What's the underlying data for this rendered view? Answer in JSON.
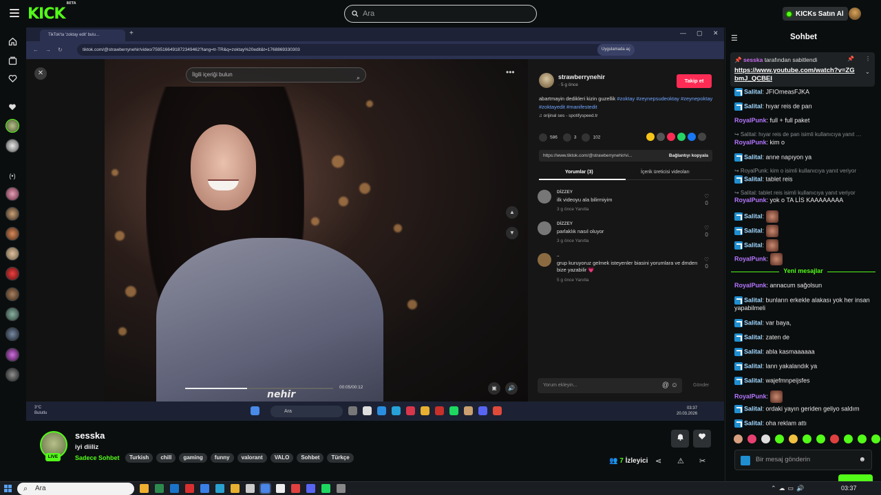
{
  "topbar": {
    "logo": "KICK",
    "logo_beta": "BETA",
    "search_placeholder": "Ara",
    "buy_kicks": "KICKs Satın Al"
  },
  "leftnav": {
    "icons": [
      "home-icon",
      "browse-icon",
      "following-icon",
      "followed-channels-icon",
      "recommended-icon"
    ]
  },
  "stream": {
    "browser": {
      "tab_title": "TikTok'ta 'zoktay edit' bulu…",
      "url": "tiktok.com/@strawberrynehir/video/7595166491872349462?lang=tr-TR&q=zoktay%20edit&t=1768869330303",
      "open_in_app": "Uygulamada aç"
    },
    "tiktok": {
      "search_placeholder": "İlgili içeriği bulun",
      "watermark": "nehir",
      "time": "00:05/00:12",
      "progress": 0.42,
      "username": "strawberrynehir",
      "date": "· 5 g önce",
      "follow": "Takip et",
      "description": "abartmayin dedikleri kizin guzellik",
      "hashtags": "#zoktay #zeynepsudeoktay #zeynepoktay #zoktayedit #manifestedit",
      "music": "♫ orijinal ses - spotifyspeed.tr",
      "likes": "586",
      "comments_count": "3",
      "saves": "102",
      "link": "https://www.tiktok.com/@strawberrynehir/vi...",
      "copy_link": "Bağlantıyı kopyala",
      "tab_comments": "Yorumlar (3)",
      "tab_creator": "İçerik üreticisi videoları",
      "comments": [
        {
          "name": "DİZZEY",
          "text": "ilk videoyu ala bilirmiyim",
          "meta": "3 g önce     Yanıtla",
          "likes": "0"
        },
        {
          "name": "DİZZEY",
          "text": "parlaklık nasıl oluyor",
          "meta": "3 g önce     Yanıtla",
          "likes": "0"
        },
        {
          "name": "..",
          "text": "grup kuruyoruz gelmek isteyenler biasini yorumlara ve dmden bize yazabilir 💗",
          "meta": "5 g önce     Yanıtla",
          "likes": "0"
        }
      ],
      "comment_placeholder": "Yorum ekleyin...",
      "send": "Gönder"
    },
    "inner_taskbar": {
      "weather_temp": "3°C",
      "weather_desc": "Bulutlu",
      "search": "Ara",
      "time": "03:37",
      "date": "20.03.2026"
    }
  },
  "channel": {
    "name": "sesska",
    "live": "LIVE",
    "title": "iyi diiliz",
    "category": "Sadece Sohbet",
    "tags": [
      "Turkish",
      "chill",
      "gaming",
      "funny",
      "valorant",
      "VALO",
      "Sohbet",
      "Türkçe"
    ],
    "viewers": "7",
    "viewers_label": "İzleyici"
  },
  "chat": {
    "title": "Sohbet",
    "pinned_by_user": "sesska",
    "pinned_by_text": " tarafından sabitlendi",
    "pinned_link": "https://www.youtube.com/watch?v=ZGbmJ_QCBEI",
    "new_messages": "Yeni mesajlar",
    "input_placeholder": "Bir mesaj gönderin",
    "messages": [
      {
        "type": "msg",
        "user": "Salital",
        "text": "JFIOmeasFJKA"
      },
      {
        "type": "msg",
        "user": "Salital",
        "text": "hıyar reis de pan"
      },
      {
        "type": "msg",
        "user": "RoyalPunk",
        "text": "full + full paket"
      },
      {
        "type": "reply",
        "text": "↪ Salital: hıyar reis de pan isimli kullanıcıya yanıt …"
      },
      {
        "type": "msg",
        "user": "RoyalPunk",
        "text": "kim o"
      },
      {
        "type": "msg",
        "user": "Salital",
        "text": "anne napıyon ya"
      },
      {
        "type": "reply",
        "text": "↪ RoyalPunk: kim o isimli kullanıcıya yanıt veriyor"
      },
      {
        "type": "msg",
        "user": "Salital",
        "text": "tablet reis"
      },
      {
        "type": "reply",
        "text": "↪ Salital: tablet reis isimli kullanıcıya yanıt veriyor"
      },
      {
        "type": "msg",
        "user": "RoyalPunk",
        "text": "yok o TA LİS KAAAAAAAA"
      },
      {
        "type": "msg",
        "user": "Salital",
        "text": ""
      },
      {
        "type": "msg",
        "user": "Salital",
        "text": ""
      },
      {
        "type": "msg",
        "user": "Salital",
        "text": ""
      },
      {
        "type": "msg",
        "user": "RoyalPunk",
        "text": ""
      },
      {
        "type": "msg",
        "user": "RoyalPunk",
        "text": "annacum sağolsun"
      },
      {
        "type": "msg",
        "user": "Salital",
        "text": "bunların erkekle alakası yok her insan yapabilmeli"
      },
      {
        "type": "msg",
        "user": "Salital",
        "text": "var baya,"
      },
      {
        "type": "msg",
        "user": "Salital",
        "text": "zaten de"
      },
      {
        "type": "msg",
        "user": "Salital",
        "text": "abla kasmaaaaaa"
      },
      {
        "type": "msg",
        "user": "Salital",
        "text": "lann yakalandık ya"
      },
      {
        "type": "msg",
        "user": "Salital",
        "text": "wajefmnpeijsfes"
      },
      {
        "type": "msg",
        "user": "RoyalPunk",
        "text": ""
      },
      {
        "type": "msg",
        "user": "Salital",
        "text": "ordaki yayın geriden geliyo saldım"
      },
      {
        "type": "msg",
        "user": "Salital",
        "text": "oha reklam attı"
      }
    ]
  },
  "wintaskbar": {
    "search": "Ara",
    "time": "03:37"
  },
  "colors": {
    "brand": "#53fc18",
    "royalpunk": "#b576ff",
    "salital": "#a2d8ff"
  }
}
